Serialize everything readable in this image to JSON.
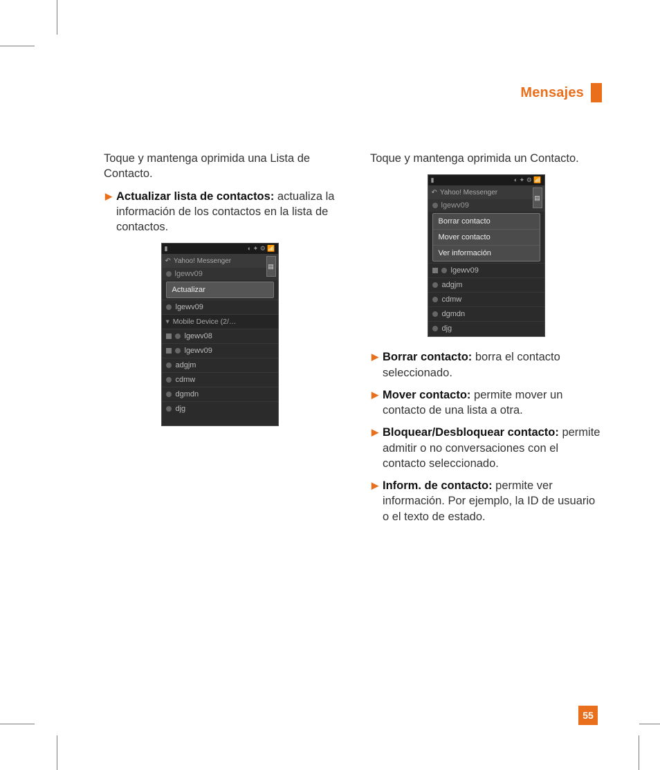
{
  "header": {
    "title": "Mensajes"
  },
  "page_number": "55",
  "left": {
    "intro": "Toque y mantenga oprimida una Lista de Contacto.",
    "bullet1_bold": "Actualizar lista de contactos:",
    "bullet1_rest": " actualiza la información de los contactos en la lista de contactos.",
    "phone": {
      "app_title": "Yahoo! Messenger",
      "user": "lgewv09",
      "menu": [
        "Actualizar"
      ],
      "rows": [
        {
          "label": "lgewv09",
          "icon": "dot"
        },
        {
          "label": "Mobile Device (2/…",
          "icon": "group"
        },
        {
          "label": "lgewv08",
          "icon": "sqdot"
        },
        {
          "label": "lgewv09",
          "icon": "sqdot"
        },
        {
          "label": "adgjm",
          "icon": "dot"
        },
        {
          "label": "cdmw",
          "icon": "dot"
        },
        {
          "label": "dgmdn",
          "icon": "dot"
        },
        {
          "label": "djg",
          "icon": "dot"
        }
      ]
    }
  },
  "right": {
    "intro": "Toque y mantenga oprimida un Contacto.",
    "phone": {
      "app_title": "Yahoo! Messenger",
      "user": "lgewv09",
      "menu": [
        "Borrar contacto",
        "Mover contacto",
        "Ver información"
      ],
      "rows": [
        {
          "label": "lgewv09",
          "icon": "sqdot"
        },
        {
          "label": "adgjm",
          "icon": "dot"
        },
        {
          "label": "cdmw",
          "icon": "dot"
        },
        {
          "label": "dgmdn",
          "icon": "dot"
        },
        {
          "label": "djg",
          "icon": "dot"
        }
      ]
    },
    "bullets": [
      {
        "bold": "Borrar contacto:",
        "rest": " borra el contacto seleccionado."
      },
      {
        "bold": "Mover contacto:",
        "rest": " permite mover un contacto de una lista a otra."
      },
      {
        "bold": "Bloquear/Desbloquear contacto:",
        "rest": " permite admitir o no conversaciones con el contacto seleccionado."
      },
      {
        "bold": "Inform. de contacto:",
        "rest": " permite ver información. Por ejemplo, la ID de usuario o el texto de estado."
      }
    ]
  }
}
